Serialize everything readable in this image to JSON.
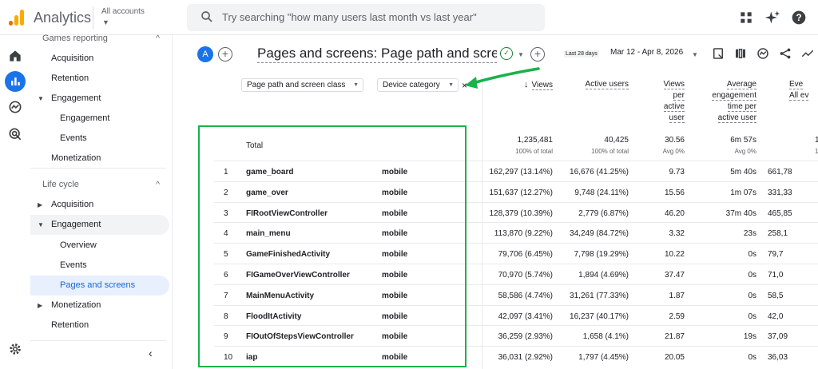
{
  "app": {
    "title": "Analytics",
    "accounts_label": "All accounts",
    "search_placeholder": "Try searching \"how many users last month vs last year\""
  },
  "colors": {
    "accent": "#1a73e8",
    "active_bg": "#e8f0fe",
    "annotation_green": "#19b24b",
    "logo_orange": "#f9ab00",
    "logo_dark": "#e37400"
  },
  "sidebar": {
    "sections": [
      {
        "label": "Games reporting",
        "type": "header",
        "chevron": "up"
      },
      {
        "label": "Acquisition",
        "type": "item",
        "level": 1
      },
      {
        "label": "Retention",
        "type": "item",
        "level": 1
      },
      {
        "label": "Engagement",
        "type": "item",
        "level": 1,
        "caret": "down"
      },
      {
        "label": "Engagement",
        "type": "item",
        "level": 2
      },
      {
        "label": "Events",
        "type": "item",
        "level": 2
      },
      {
        "label": "Monetization",
        "type": "item",
        "level": 1
      },
      {
        "label": "Life cycle",
        "type": "header",
        "chevron": "up"
      },
      {
        "label": "Acquisition",
        "type": "item",
        "level": 1,
        "caret": "right"
      },
      {
        "label": "Engagement",
        "type": "item",
        "level": 1,
        "caret": "down"
      },
      {
        "label": "Overview",
        "type": "item",
        "level": 2
      },
      {
        "label": "Events",
        "type": "item",
        "level": 2
      },
      {
        "label": "Pages and screens",
        "type": "item",
        "level": 2,
        "active": true
      },
      {
        "label": "Monetization",
        "type": "item",
        "level": 1,
        "caret": "right"
      },
      {
        "label": "Retention",
        "type": "item",
        "level": 1
      }
    ]
  },
  "report": {
    "avatar_letter": "A",
    "title": "Pages and screens: Page path and screen class",
    "date_badge": "Last 28 days",
    "date_range": "Mar 12 - Apr 8, 2026"
  },
  "table": {
    "dimension_1": "Page path and screen class",
    "dimension_2": "Device category",
    "columns": [
      {
        "lines": [
          "Views"
        ],
        "sorted": true
      },
      {
        "lines": [
          "Active users"
        ]
      },
      {
        "lines": [
          "Views",
          "per",
          "active",
          "user"
        ]
      },
      {
        "lines": [
          "Average",
          "engagement",
          "time per",
          "active user"
        ]
      },
      {
        "lines": [
          "Eve",
          "All ev"
        ]
      }
    ],
    "total_label": "Total",
    "totals": [
      {
        "value": "1,235,481",
        "sub": "100% of total"
      },
      {
        "value": "40,425",
        "sub": "100% of total"
      },
      {
        "value": "30.56",
        "sub": "Avg 0%"
      },
      {
        "value": "6m 57s",
        "sub": "Avg 0%"
      },
      {
        "value": "1",
        "sub": "1"
      }
    ],
    "rows": [
      {
        "n": "1",
        "name": "game_board",
        "device": "mobile",
        "views": "162,297 (13.14%)",
        "users": "16,676 (41.25%)",
        "vpu": "9.73",
        "time": "5m 40s",
        "events": "661,78"
      },
      {
        "n": "2",
        "name": "game_over",
        "device": "mobile",
        "views": "151,637 (12.27%)",
        "users": "9,748 (24.11%)",
        "vpu": "15.56",
        "time": "1m 07s",
        "events": "331,33"
      },
      {
        "n": "3",
        "name": "FIRootViewController",
        "device": "mobile",
        "views": "128,379 (10.39%)",
        "users": "2,779 (6.87%)",
        "vpu": "46.20",
        "time": "37m 40s",
        "events": "465,85"
      },
      {
        "n": "4",
        "name": "main_menu",
        "device": "mobile",
        "views": "113,870 (9.22%)",
        "users": "34,249 (84.72%)",
        "vpu": "3.32",
        "time": "23s",
        "events": "258,1"
      },
      {
        "n": "5",
        "name": "GameFinishedActivity",
        "device": "mobile",
        "views": "79,706 (6.45%)",
        "users": "7,798 (19.29%)",
        "vpu": "10.22",
        "time": "0s",
        "events": "79,7"
      },
      {
        "n": "6",
        "name": "FIGameOverViewController",
        "device": "mobile",
        "views": "70,970 (5.74%)",
        "users": "1,894 (4.69%)",
        "vpu": "37.47",
        "time": "0s",
        "events": "71,0"
      },
      {
        "n": "7",
        "name": "MainMenuActivity",
        "device": "mobile",
        "views": "58,586 (4.74%)",
        "users": "31,261 (77.33%)",
        "vpu": "1.87",
        "time": "0s",
        "events": "58,5"
      },
      {
        "n": "8",
        "name": "FloodItActivity",
        "device": "mobile",
        "views": "42,097 (3.41%)",
        "users": "16,237 (40.17%)",
        "vpu": "2.59",
        "time": "0s",
        "events": "42,0"
      },
      {
        "n": "9",
        "name": "FIOutOfStepsViewController",
        "device": "mobile",
        "views": "36,259 (2.93%)",
        "users": "1,658 (4.1%)",
        "vpu": "21.87",
        "time": "19s",
        "events": "37,09"
      },
      {
        "n": "10",
        "name": "iap",
        "device": "mobile",
        "views": "36,031 (2.92%)",
        "users": "1,797 (4.45%)",
        "vpu": "20.05",
        "time": "0s",
        "events": "36,03"
      }
    ]
  }
}
